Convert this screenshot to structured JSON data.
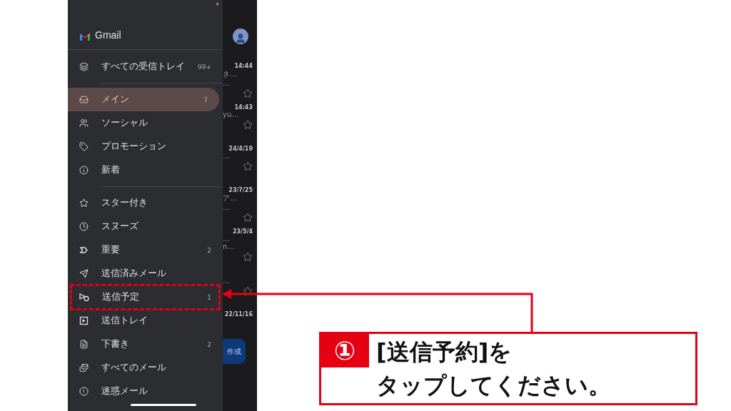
{
  "drawer": {
    "app_name": "Gmail",
    "sections": [
      [
        {
          "label": "すべての受信トレイ",
          "count": "99+",
          "selected": false,
          "highlighted": false
        }
      ],
      [
        {
          "label": "メイン",
          "count": "7",
          "selected": true,
          "highlighted": false
        },
        {
          "label": "ソーシャル",
          "selected": false,
          "highlighted": false
        },
        {
          "label": "プロモーション",
          "selected": false,
          "highlighted": false
        },
        {
          "label": "新着",
          "selected": false,
          "highlighted": false
        }
      ],
      [
        {
          "label": "スター付き",
          "selected": false,
          "highlighted": false
        },
        {
          "label": "スヌーズ",
          "selected": false,
          "highlighted": false
        },
        {
          "label": "重要",
          "count": "2",
          "selected": false,
          "highlighted": false
        },
        {
          "label": "送信済みメール",
          "selected": false,
          "highlighted": false
        },
        {
          "label": "送信予定",
          "count": "1",
          "selected": false,
          "highlighted": true
        },
        {
          "label": "送信トレイ",
          "selected": false,
          "highlighted": false
        },
        {
          "label": "下書き",
          "count": "2",
          "selected": false,
          "highlighted": false
        },
        {
          "label": "すべてのメール",
          "selected": false,
          "highlighted": false
        },
        {
          "label": "迷惑メール",
          "selected": false,
          "highlighted": false
        }
      ]
    ]
  },
  "mail_list": {
    "compose_label": "作成",
    "entries": [
      {
        "time": "14:44",
        "snippets": [
          "き…",
          "…"
        ]
      },
      {
        "time": "14:43",
        "snippets": [
          "yu…"
        ]
      },
      {
        "time": "24/4/19",
        "snippets": [
          "…"
        ]
      },
      {
        "time": "23/7/25",
        "snippets": [
          "ア…",
          "…"
        ]
      },
      {
        "time": "23/5/4",
        "snippets": [
          "…",
          "n…"
        ]
      },
      {
        "snippets": [
          "…"
        ]
      },
      {
        "time": "22/11/16"
      }
    ]
  },
  "callout": {
    "step": "①",
    "lines": [
      "[送信予約]を",
      "タップしてください。"
    ]
  }
}
